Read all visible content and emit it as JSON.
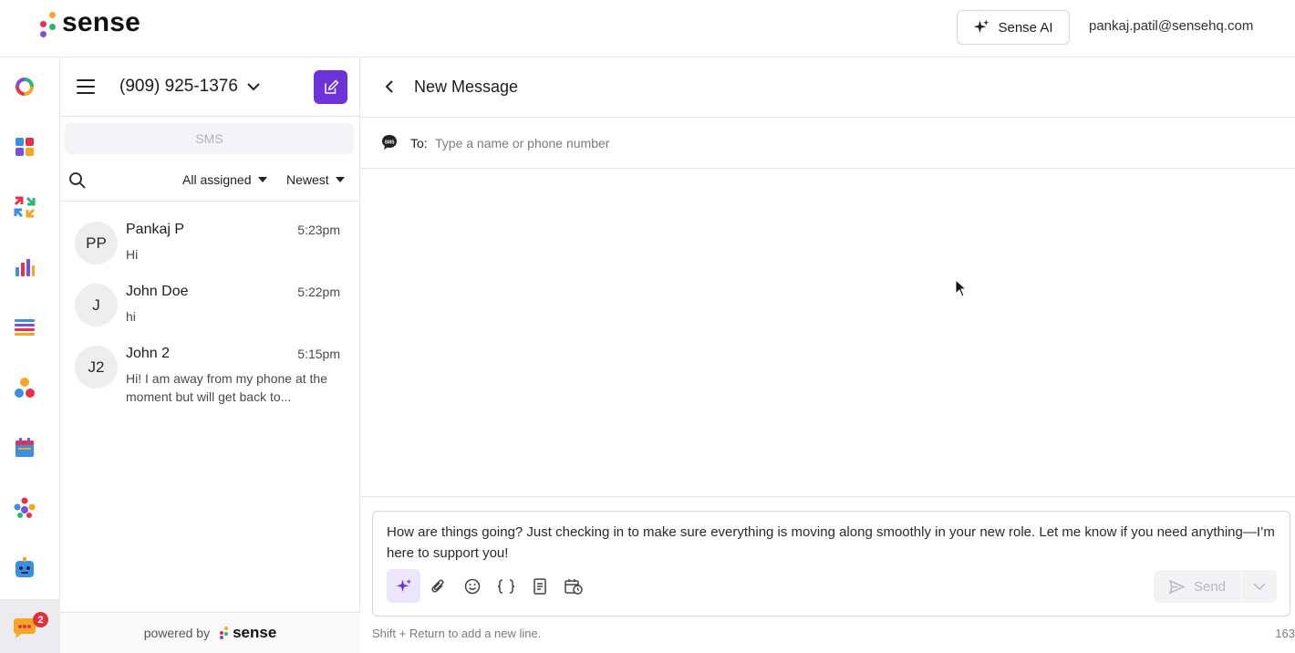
{
  "app": {
    "brand": "sense",
    "ai_button_label": "Sense AI",
    "user_email": "pankaj.patil@sensehq.com"
  },
  "rail": {
    "items": [
      "overview-icon",
      "dashboard-icon",
      "integrations-icon",
      "analytics-icon",
      "lists-icon",
      "people-icon",
      "calendar-icon",
      "team-icon",
      "bot-icon",
      "messages-icon"
    ],
    "messages_badge": "2"
  },
  "inbox": {
    "phone_number": "(909) 925-1376",
    "channel_tab": "SMS",
    "filter_assigned": "All assigned",
    "filter_sort": "Newest",
    "conversations": [
      {
        "initials": "PP",
        "name": "Pankaj P",
        "time": "5:23pm",
        "preview": "Hi"
      },
      {
        "initials": "J",
        "name": "John Doe",
        "time": "5:22pm",
        "preview": "hi"
      },
      {
        "initials": "J2",
        "name": "John 2",
        "time": "5:15pm",
        "preview": "Hi! I am away from my phone at the moment but will get back to..."
      }
    ],
    "powered_by": "powered by",
    "powered_brand": "sense"
  },
  "compose": {
    "title": "New Message",
    "to_label": "To:",
    "to_placeholder": "Type a name or phone number",
    "message_text": "How are things going? Just checking in to make sure everything is moving along smoothly in your new role. Let me know if you need anything—I’m here to support you!",
    "send_label": "Send",
    "hint": "Shift + Return to add a new line.",
    "char_count": "163"
  },
  "colors": {
    "accent": "#6c34d8",
    "badge": "#e0313c"
  }
}
